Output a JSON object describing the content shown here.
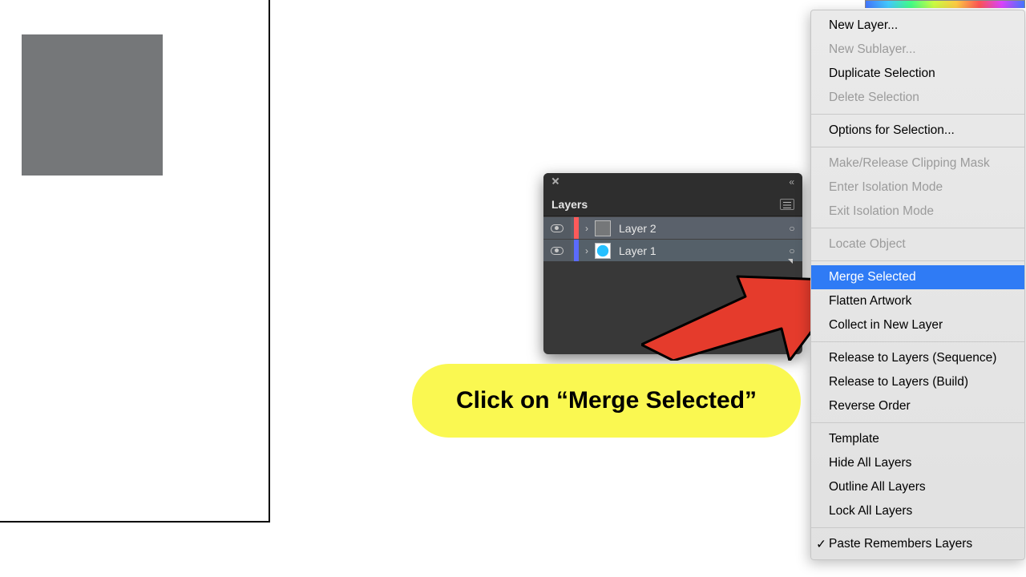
{
  "artboard": {
    "square_color": "#757779"
  },
  "layers_panel": {
    "title": "Layers",
    "rows": [
      {
        "name": "Layer 2",
        "color": "#ff5a5a",
        "swatch": "#757779",
        "swatch_shape": "square"
      },
      {
        "name": "Layer 1",
        "color": "#5a6bff",
        "swatch": "#26c0ff",
        "swatch_shape": "circle"
      }
    ]
  },
  "flyout": {
    "items": [
      {
        "label": "New Layer...",
        "enabled": true
      },
      {
        "label": "New Sublayer...",
        "enabled": false
      },
      {
        "label": "Duplicate Selection",
        "enabled": true
      },
      {
        "label": "Delete Selection",
        "enabled": false
      },
      {
        "sep": true
      },
      {
        "label": "Options for Selection...",
        "enabled": true
      },
      {
        "sep": true
      },
      {
        "label": "Make/Release Clipping Mask",
        "enabled": false
      },
      {
        "label": "Enter Isolation Mode",
        "enabled": false
      },
      {
        "label": "Exit Isolation Mode",
        "enabled": false
      },
      {
        "sep": true
      },
      {
        "label": "Locate Object",
        "enabled": false
      },
      {
        "sep": true
      },
      {
        "label": "Merge Selected",
        "enabled": true,
        "highlight": true
      },
      {
        "label": "Flatten Artwork",
        "enabled": true
      },
      {
        "label": "Collect in New Layer",
        "enabled": true
      },
      {
        "sep": true
      },
      {
        "label": "Release to Layers (Sequence)",
        "enabled": true
      },
      {
        "label": "Release to Layers (Build)",
        "enabled": true
      },
      {
        "label": "Reverse Order",
        "enabled": true
      },
      {
        "sep": true
      },
      {
        "label": "Template",
        "enabled": true
      },
      {
        "label": "Hide All Layers",
        "enabled": true
      },
      {
        "label": "Outline All Layers",
        "enabled": true
      },
      {
        "label": "Lock All Layers",
        "enabled": true
      },
      {
        "sep": true
      },
      {
        "label": "Paste Remembers Layers",
        "enabled": true,
        "checked": true
      }
    ]
  },
  "callout": {
    "text": "Click on “Merge Selected”"
  }
}
